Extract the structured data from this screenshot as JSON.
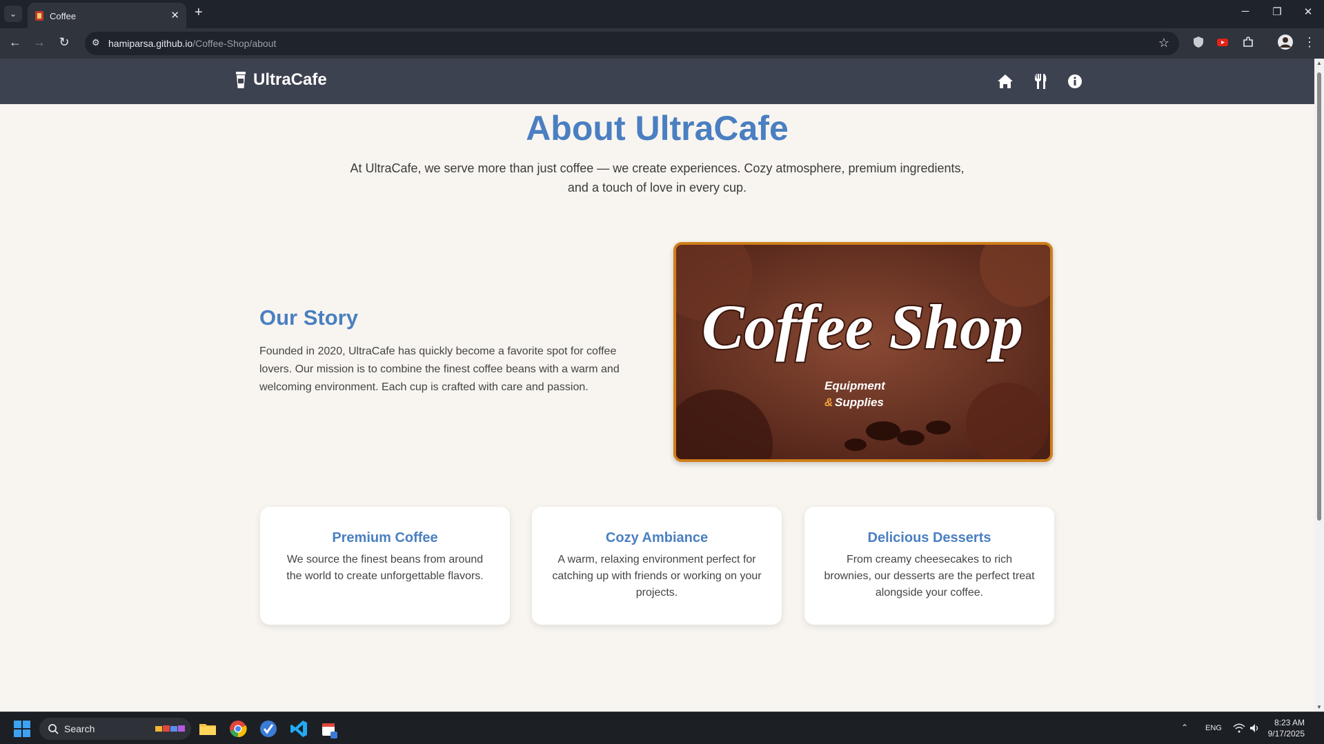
{
  "browser": {
    "tab_title": "Coffee",
    "url_host": "hamiparsa.github.io",
    "url_path": "/Coffee-Shop/about"
  },
  "site": {
    "brand": "UltraCafe",
    "nav": [
      "home-icon",
      "utensils-icon",
      "info-icon"
    ]
  },
  "about": {
    "title": "About UltraCafe",
    "intro": "At UltraCafe, we serve more than just coffee — we create experiences. Cozy atmosphere, premium ingredients, and a touch of love in every cup."
  },
  "story": {
    "title": "Our Story",
    "text": "Founded in 2020, UltraCafe has quickly become a favorite spot for coffee lovers. Our mission is to combine the finest coffee beans with a warm and welcoming environment. Each cup is crafted with care and passion.",
    "image_text_main": "Coffee Shop",
    "image_text_sub1": "Equipment",
    "image_text_amp": "&",
    "image_text_sub2": "Supplies"
  },
  "features": [
    {
      "title": "Premium Coffee",
      "text": "We source the finest beans from around the world to create unforgettable flavors."
    },
    {
      "title": "Cozy Ambiance",
      "text": "A warm, relaxing environment perfect for catching up with friends or working on your projects."
    },
    {
      "title": "Delicious Desserts",
      "text": "From creamy cheesecakes to rich brownies, our desserts are the perfect treat alongside your coffee."
    }
  ],
  "taskbar": {
    "search_label": "Search",
    "lang": "ENG",
    "time": "8:23 AM",
    "date": "9/17/2025"
  },
  "colors": {
    "accent": "#4a7fc1",
    "header": "#3d4250",
    "page_bg": "#f8f5f0",
    "image_border": "#cf7f1a"
  }
}
